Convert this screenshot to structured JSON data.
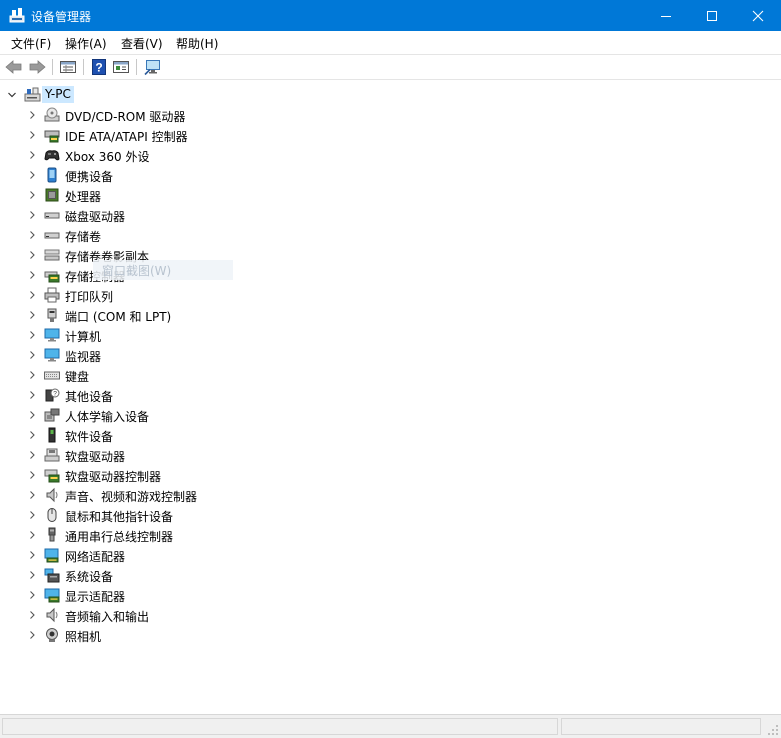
{
  "window": {
    "title": "设备管理器",
    "accent_color": "#0078d7"
  },
  "menu": [
    "文件(F)",
    "操作(A)",
    "查看(V)",
    "帮助(H)"
  ],
  "toolbar": [
    "back-arrow-icon",
    "forward-arrow-icon",
    "properties-icon",
    "help-icon",
    "details-icon",
    "monitor-scan-icon"
  ],
  "tree": {
    "root": {
      "label": "Y-PC",
      "icon": "computer-icon",
      "expanded": true,
      "selected_color": "#cce8ff"
    },
    "items": [
      {
        "label": "DVD/CD-ROM 驱动器",
        "icon": "optical-drive-icon"
      },
      {
        "label": "IDE ATA/ATAPI 控制器",
        "icon": "ide-controller-icon"
      },
      {
        "label": "Xbox 360 外设",
        "icon": "gamepad-icon"
      },
      {
        "label": "便携设备",
        "icon": "portable-device-icon"
      },
      {
        "label": "处理器",
        "icon": "processor-icon"
      },
      {
        "label": "磁盘驱动器",
        "icon": "disk-drive-icon"
      },
      {
        "label": "存储卷",
        "icon": "storage-volume-icon"
      },
      {
        "label": "存储卷卷影副本",
        "icon": "shadow-copy-icon"
      },
      {
        "label": "存储控制器",
        "icon": "storage-controller-icon"
      },
      {
        "label": "打印队列",
        "icon": "printer-icon"
      },
      {
        "label": "端口 (COM 和 LPT)",
        "icon": "port-icon"
      },
      {
        "label": "计算机",
        "icon": "computer-monitor-icon"
      },
      {
        "label": "监视器",
        "icon": "monitor-icon"
      },
      {
        "label": "键盘",
        "icon": "keyboard-icon"
      },
      {
        "label": "其他设备",
        "icon": "unknown-device-icon"
      },
      {
        "label": "人体学输入设备",
        "icon": "hid-icon"
      },
      {
        "label": "软件设备",
        "icon": "software-device-icon"
      },
      {
        "label": "软盘驱动器",
        "icon": "floppy-drive-icon"
      },
      {
        "label": "软盘驱动器控制器",
        "icon": "floppy-controller-icon"
      },
      {
        "label": "声音、视频和游戏控制器",
        "icon": "speaker-icon"
      },
      {
        "label": "鼠标和其他指针设备",
        "icon": "mouse-icon"
      },
      {
        "label": "通用串行总线控制器",
        "icon": "usb-icon"
      },
      {
        "label": "网络适配器",
        "icon": "network-adapter-icon"
      },
      {
        "label": "系统设备",
        "icon": "system-device-icon"
      },
      {
        "label": "显示适配器",
        "icon": "display-adapter-icon"
      },
      {
        "label": "音频输入和输出",
        "icon": "audio-io-icon"
      },
      {
        "label": "照相机",
        "icon": "camera-icon"
      }
    ]
  },
  "ghost_tooltip": "窗口截图(W)"
}
